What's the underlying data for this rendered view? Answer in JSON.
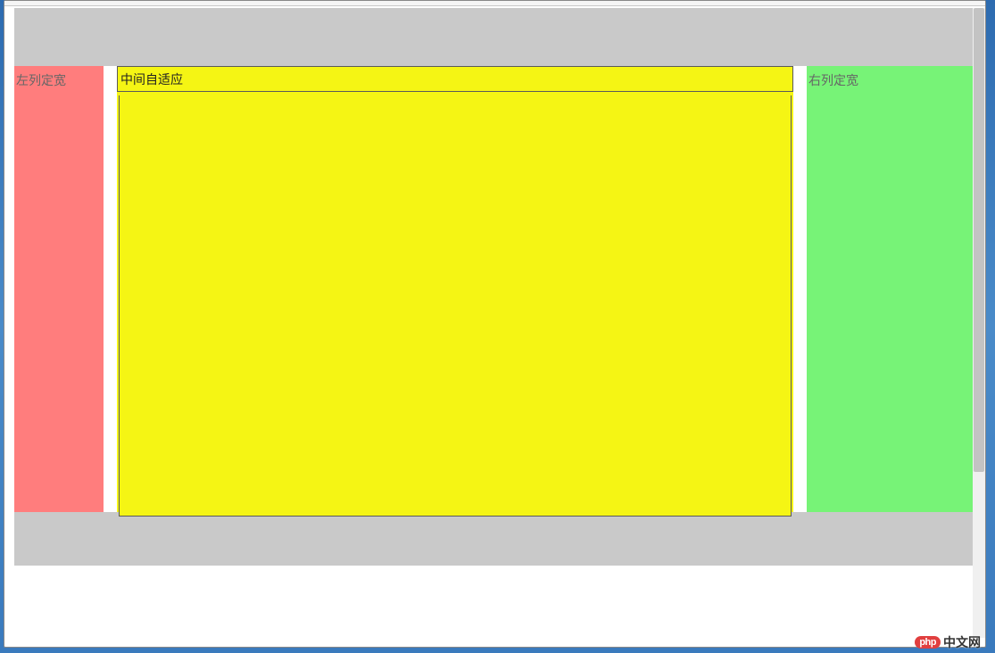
{
  "columns": {
    "left": {
      "label": "左列定宽"
    },
    "middle": {
      "title": "中间自适应"
    },
    "right": {
      "label": "右列定宽"
    }
  },
  "watermark": {
    "logo_text": "php",
    "brand_text": "中文网"
  }
}
